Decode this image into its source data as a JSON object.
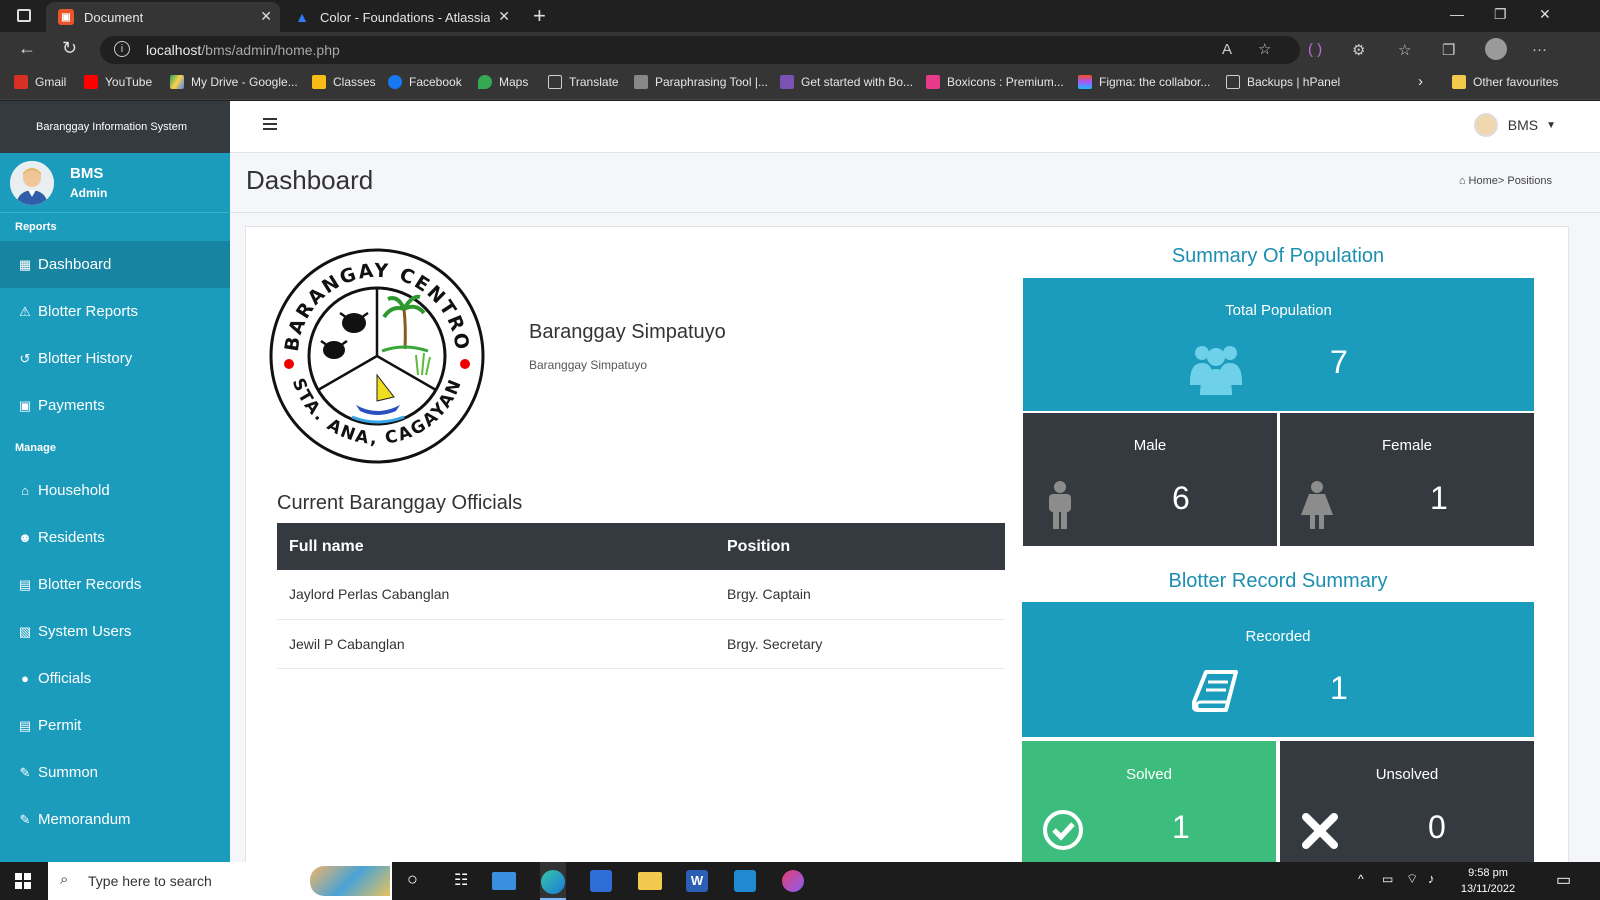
{
  "browser": {
    "tabs": [
      {
        "title": "Document",
        "active": true
      },
      {
        "title": "Color - Foundations - Atlassian D",
        "active": false
      }
    ],
    "url_host": "localhost",
    "url_path": "/bms/admin/home.php",
    "bookmarks": [
      "Gmail",
      "YouTube",
      "My Drive - Google...",
      "Classes",
      "Facebook",
      "Maps",
      "Translate",
      "Paraphrasing Tool |...",
      "Get started with Bo...",
      "Boxicons : Premium...",
      "Figma: the collabor...",
      "Backups | hPanel",
      "Other favourites"
    ]
  },
  "app": {
    "brand": "Baranggay Information System",
    "user_menu": "BMS",
    "profile": {
      "name": "BMS",
      "role": "Admin"
    },
    "sections": {
      "reports": "Reports",
      "manage": "Manage"
    },
    "reports_items": [
      "Dashboard",
      "Blotter Reports",
      "Blotter History",
      "Payments"
    ],
    "manage_items": [
      "Household",
      "Residents",
      "Blotter Records",
      "System Users",
      "Officials",
      "Permit",
      "Summon",
      "Memorandum"
    ],
    "page_title": "Dashboard",
    "breadcrumb": "Home> Positions"
  },
  "barangay": {
    "name": "Baranggay Simpatuyo",
    "subtitle": "Baranggay Simpatuyo",
    "seal_top": "BARANGAY CENTRO",
    "seal_bottom": "STA. ANA, CAGAYAN"
  },
  "officials": {
    "title": "Current Baranggay Officials",
    "headers": [
      "Full name",
      "Position"
    ],
    "rows": [
      {
        "name": "Jaylord Perlas Cabanglan",
        "position": "Brgy. Captain"
      },
      {
        "name": "Jewil P Cabanglan",
        "position": "Brgy. Secretary"
      }
    ]
  },
  "population": {
    "title": "Summary Of Population",
    "total_label": "Total Population",
    "total": "7",
    "male_label": "Male",
    "male": "6",
    "female_label": "Female",
    "female": "1"
  },
  "blotter": {
    "title": "Blotter Record Summary",
    "recorded_label": "Recorded",
    "recorded": "1",
    "solved_label": "Solved",
    "solved": "1",
    "unsolved_label": "Unsolved",
    "unsolved": "0"
  },
  "taskbar": {
    "search_placeholder": "Type here to search",
    "time": "9:58 pm",
    "date": "13/11/2022"
  },
  "colors": {
    "teal": "#1c9cbd",
    "dark": "#343a40",
    "green": "#3dbd7d"
  }
}
